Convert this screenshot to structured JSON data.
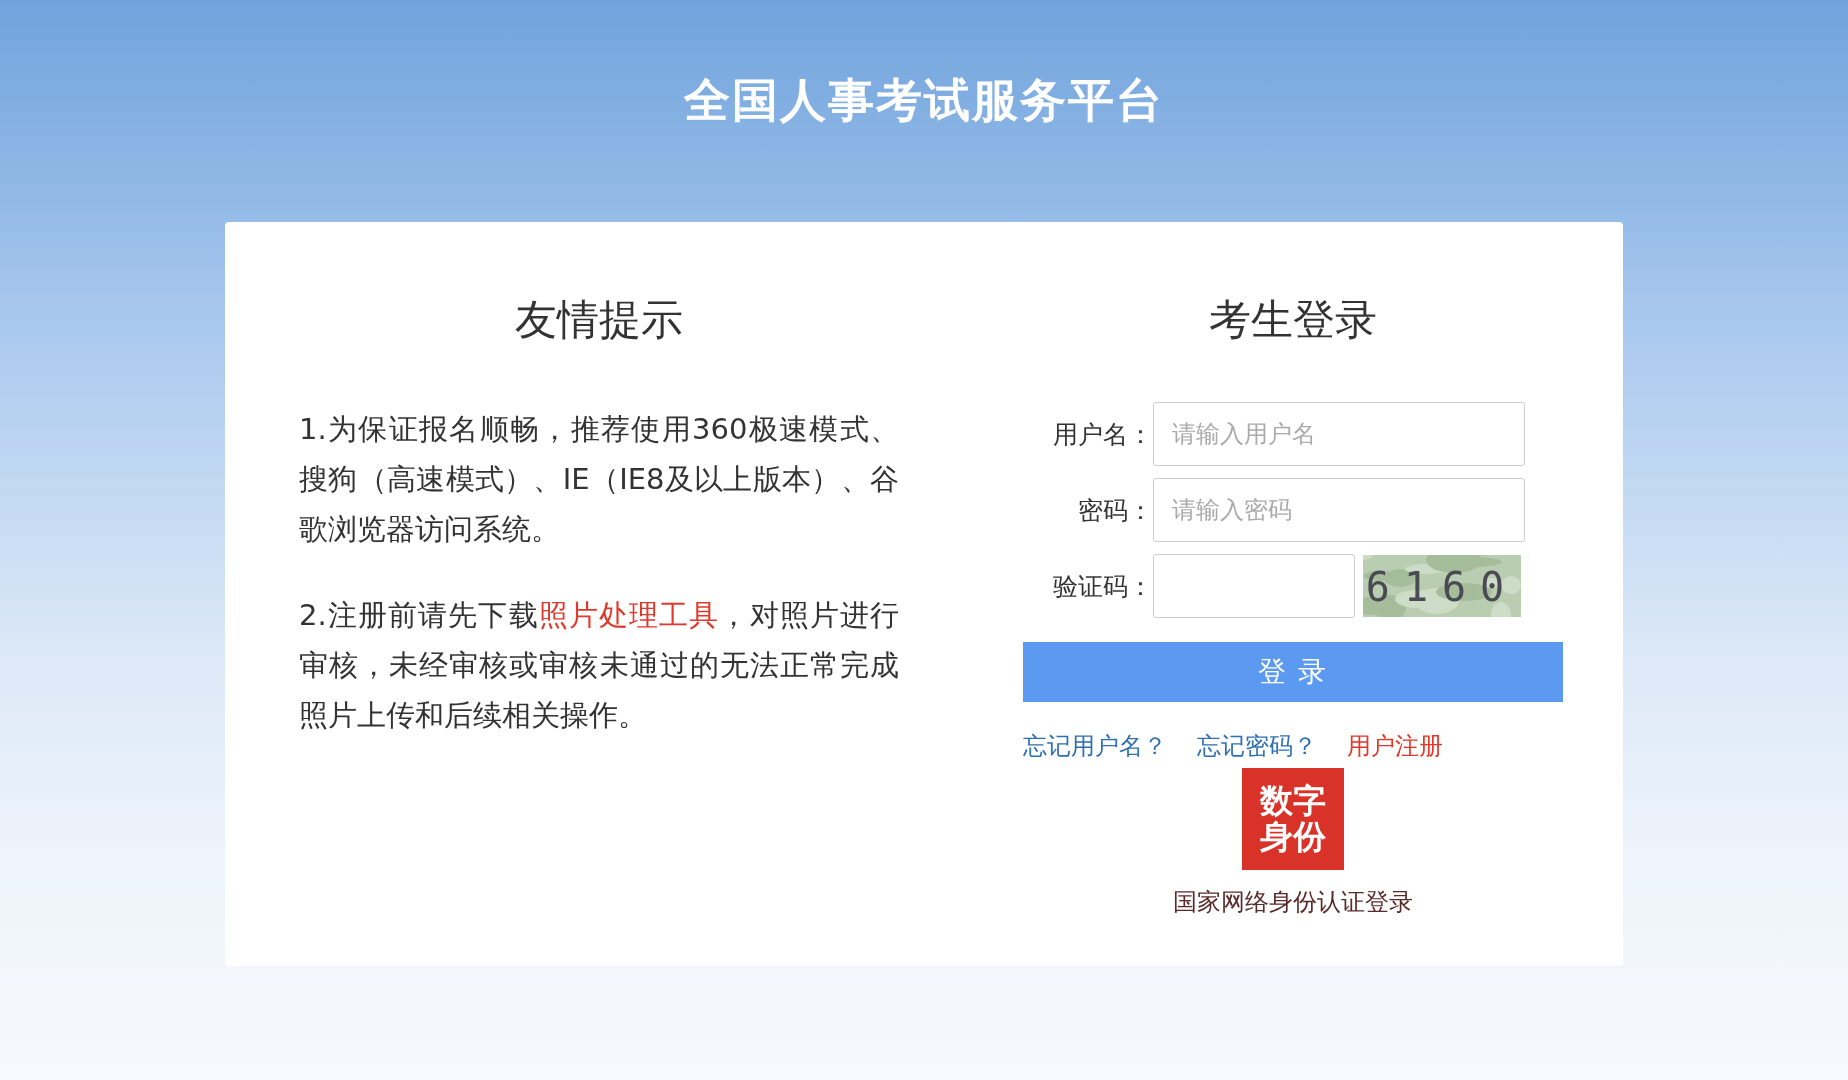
{
  "site_title": "全国人事考试服务平台",
  "notice": {
    "heading": "友情提示",
    "items": [
      {
        "kind": "plain",
        "text": "1.为保证报名顺畅，推荐使用360极速模式、搜狗（高速模式）、IE（IE8及以上版本）、谷歌浏览器访问系统。"
      },
      {
        "kind": "link",
        "before": "2.注册前请先下载",
        "link": "照片处理工具",
        "after": "，对照片进行审核，未经审核或审核未通过的无法正常完成照片上传和后续相关操作。"
      }
    ]
  },
  "login": {
    "heading": "考生登录",
    "fields": [
      {
        "kind": "text",
        "label": "用户名：",
        "placeholder": "请输入用户名"
      },
      {
        "kind": "password",
        "label": "密码：",
        "placeholder": "请输入密码"
      },
      {
        "kind": "captcha",
        "label": "验证码：",
        "code": "6160"
      }
    ],
    "submit": "登 录",
    "links": [
      {
        "text": "忘记用户名？",
        "color": "#2f6fb3"
      },
      {
        "text": "忘记密码？",
        "color": "#2f6fb3"
      },
      {
        "text": "用户注册",
        "color": "#e0382a"
      }
    ],
    "badge": {
      "lines": [
        "数字",
        "身份"
      ]
    },
    "badge_caption": "国家网络身份认证登录"
  }
}
